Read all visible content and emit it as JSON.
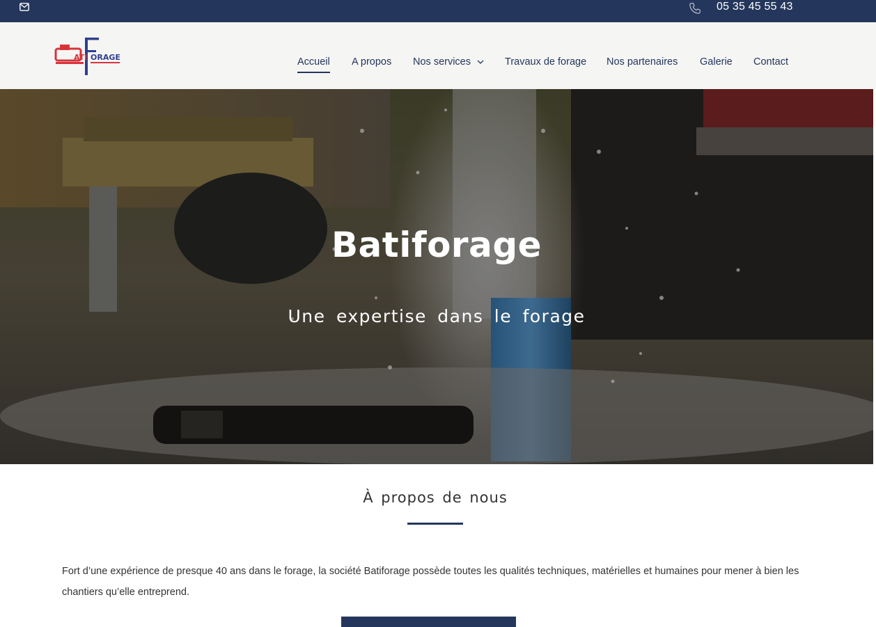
{
  "topbar": {
    "email_icon": "mail-icon",
    "phone_icon": "phone-icon",
    "phone": "05 35 45 55 43"
  },
  "header": {
    "logo": "Batiforage logo",
    "nav": [
      {
        "label": "Accueil",
        "active": true
      },
      {
        "label": "A propos"
      },
      {
        "label": "Nos services",
        "has_dropdown": true
      },
      {
        "label": "Travaux de forage"
      },
      {
        "label": "Nos partenaires"
      },
      {
        "label": "Galerie"
      },
      {
        "label": "Contact"
      }
    ]
  },
  "hero": {
    "title": "Batiforage",
    "subtitle": "Une expertise dans le forage"
  },
  "about": {
    "title": "À propos de nous",
    "text": "Fort d’une expérience de presque 40 ans dans le forage, la société Batiforage possède toutes les qualités techniques, matérielles et humaines pour mener à bien les chantiers qu’elle entreprend."
  },
  "colors": {
    "brand": "#24365b",
    "header_bg": "#f5f5f4",
    "logo_red": "#d7343a",
    "logo_blue": "#2f3f8f"
  }
}
